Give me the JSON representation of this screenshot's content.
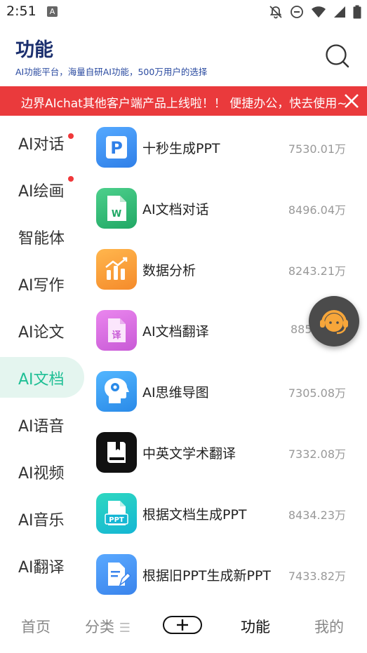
{
  "status": {
    "time": "2:51",
    "notification_badge": "A",
    "icons": [
      "notifications-off-icon",
      "do-not-disturb-icon",
      "wifi-icon",
      "cell-signal-icon",
      "battery-icon"
    ]
  },
  "header": {
    "title": "功能",
    "subtitle": "AI功能平台，海量自研AI功能，500万用户的选择"
  },
  "banner": {
    "text": "边界AIchat其他客户端产品上线啦！！ 便捷办公，快去使用~"
  },
  "sidebar": {
    "items": [
      {
        "label": "AI对话",
        "badge": true
      },
      {
        "label": "AI绘画",
        "badge": true
      },
      {
        "label": "智能体",
        "badge": false
      },
      {
        "label": "AI写作",
        "badge": false
      },
      {
        "label": "AI论文",
        "badge": false
      },
      {
        "label": "AI文档",
        "badge": false,
        "selected": true
      },
      {
        "label": "AI语音",
        "badge": false
      },
      {
        "label": "AI视频",
        "badge": false
      },
      {
        "label": "AI音乐",
        "badge": false
      },
      {
        "label": "AI翻译",
        "badge": false
      }
    ]
  },
  "features": [
    {
      "name": "十秒生成PPT",
      "count": "7530.01万",
      "icon": "ppt-p-icon",
      "color": "#3b8ff0"
    },
    {
      "name": "AI文档对话",
      "count": "8496.04万",
      "icon": "word-doc-icon",
      "color": "#2eb872"
    },
    {
      "name": "数据分析",
      "count": "8243.21万",
      "icon": "bar-chart-icon",
      "color": "#f7a13a"
    },
    {
      "name": "AI文档翻译",
      "count": "885",
      "icon": "translate-doc-icon",
      "color": "#d96ae0"
    },
    {
      "name": "AI思维导图",
      "count": "7305.08万",
      "icon": "brain-head-icon",
      "color": "#2f98f0"
    },
    {
      "name": "中英文学术翻译",
      "count": "7332.08万",
      "icon": "book-icon",
      "color": "#111111"
    },
    {
      "name": "根据文档生成PPT",
      "count": "8434.23万",
      "icon": "ppt-doc-icon",
      "color": "#22c8b8"
    },
    {
      "name": "根据旧PPT生成新PPT",
      "count": "7433.82万",
      "icon": "edit-doc-icon",
      "color": "#3f8ff0"
    }
  ],
  "tabbar": {
    "home": "首页",
    "category": "分类",
    "category_mark": "☰",
    "features": "功能",
    "mine": "我的"
  },
  "colors": {
    "brand_navy": "#1b2f6e",
    "banner_red": "#ea3a3c",
    "accent_green": "#1fbf95",
    "active_bg": "#e4f5ef"
  }
}
